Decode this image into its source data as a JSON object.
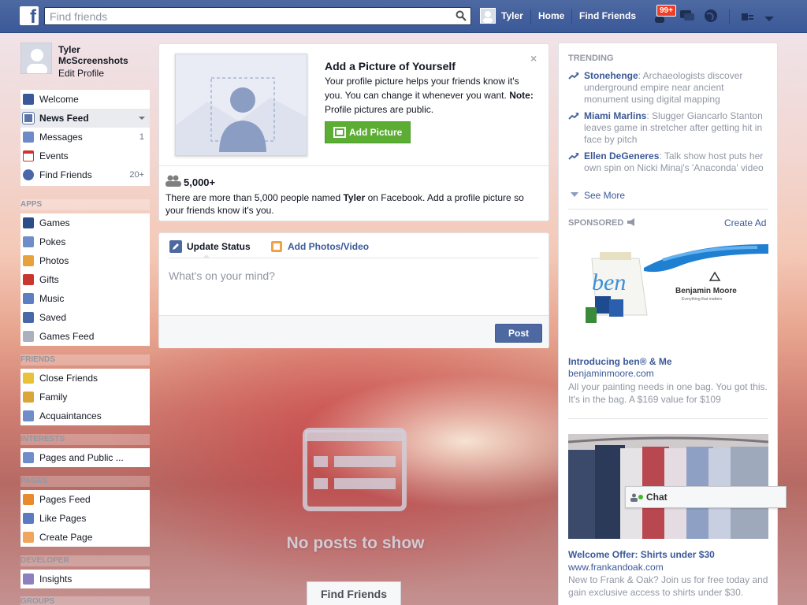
{
  "topbar": {
    "search_placeholder": "Find friends",
    "user_name": "Tyler",
    "home": "Home",
    "find_friends": "Find Friends",
    "notif_badge": "99+"
  },
  "profile": {
    "name": "Tyler McScreenshots",
    "edit": "Edit Profile"
  },
  "sidebar": {
    "favorites": [
      {
        "label": "Welcome",
        "count": ""
      },
      {
        "label": "News Feed",
        "count": ""
      },
      {
        "label": "Messages",
        "count": "1"
      },
      {
        "label": "Events",
        "count": ""
      },
      {
        "label": "Find Friends",
        "count": "20+"
      }
    ],
    "apps_head": "APPS",
    "apps": [
      {
        "label": "Games"
      },
      {
        "label": "Pokes"
      },
      {
        "label": "Photos"
      },
      {
        "label": "Gifts"
      },
      {
        "label": "Music"
      },
      {
        "label": "Saved"
      },
      {
        "label": "Games Feed"
      }
    ],
    "friends_head": "FRIENDS",
    "friends": [
      {
        "label": "Close Friends"
      },
      {
        "label": "Family"
      },
      {
        "label": "Acquaintances"
      }
    ],
    "interests_head": "INTERESTS",
    "interests": [
      {
        "label": "Pages and Public ..."
      }
    ],
    "pages_head": "PAGES",
    "pages": [
      {
        "label": "Pages Feed"
      },
      {
        "label": "Like Pages"
      },
      {
        "label": "Create Page"
      }
    ],
    "developer_head": "DEVELOPER",
    "developer": [
      {
        "label": "Insights"
      }
    ],
    "groups_head": "GROUPS"
  },
  "add_picture": {
    "title": "Add a Picture of Yourself",
    "text": "Your profile picture helps your friends know it's you. You can change it whenever you want.",
    "note_label": "Note:",
    "note_text": " Profile pictures are public.",
    "button": "Add Picture",
    "close": "×",
    "people_count": "5,000+",
    "people_text_1": "There are more than 5,000 people named ",
    "people_name": "Tyler",
    "people_text_2": " on Facebook. Add a profile picture so your friends know it's you."
  },
  "composer": {
    "tab_status": "Update Status",
    "tab_photos": "Add Photos/Video",
    "placeholder": "What's on your mind?",
    "post": "Post"
  },
  "feed": {
    "empty": "No posts to show",
    "find_friends": "Find Friends"
  },
  "trending": {
    "head": "TRENDING",
    "items": [
      {
        "topic": "Stonehenge",
        "text": ": Archaeologists discover underground empire near ancient monument using digital mapping"
      },
      {
        "topic": "Miami Marlins",
        "text": ": Slugger Giancarlo Stanton leaves game in stretcher after getting hit in face by pitch"
      },
      {
        "topic": "Ellen DeGeneres",
        "text": ": Talk show host puts her own spin on Nicki Minaj's 'Anaconda' video"
      }
    ],
    "see_more": "See More"
  },
  "sponsored": {
    "head": "SPONSORED",
    "create_ad": "Create Ad",
    "ads": [
      {
        "title": "Introducing ben® & Me",
        "url": "benjaminmoore.com",
        "body": "All your painting needs in one bag. You got this. It's in the bag. A $169 value for $109",
        "brand": "Benjamin Moore",
        "brand_tag": "Everything that matters",
        "bag_text": "ben"
      },
      {
        "title": "Welcome Offer: Shirts under $30",
        "url": "www.frankandoak.com",
        "body": "New to Frank & Oak? Join us for free today and gain exclusive access to shirts under $30."
      }
    ]
  },
  "chat": {
    "label": "Chat"
  },
  "colors": {
    "brand_blue": "#3b5998",
    "add_picture_green": "#5bad33",
    "badge_red": "#f03d25"
  }
}
